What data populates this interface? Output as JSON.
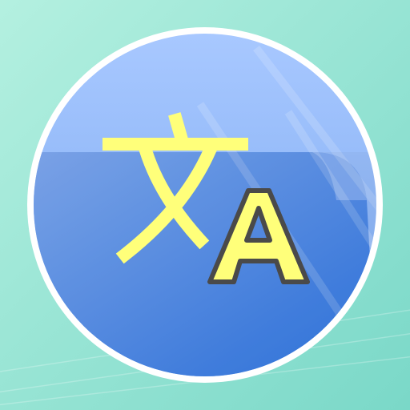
{
  "icon": {
    "name": "translate-icon",
    "colors": {
      "background_light": "#b4f0e0",
      "background_dark": "#7ad8c8",
      "ring": "#ffffff",
      "disc_light": "#a8c8ff",
      "disc_mid": "#7aa8f0",
      "card_light": "#7fa8ee",
      "card_dark": "#2e74e0",
      "glyph": "#ffff7a",
      "glyph_outline": "#4a4a4a"
    }
  }
}
